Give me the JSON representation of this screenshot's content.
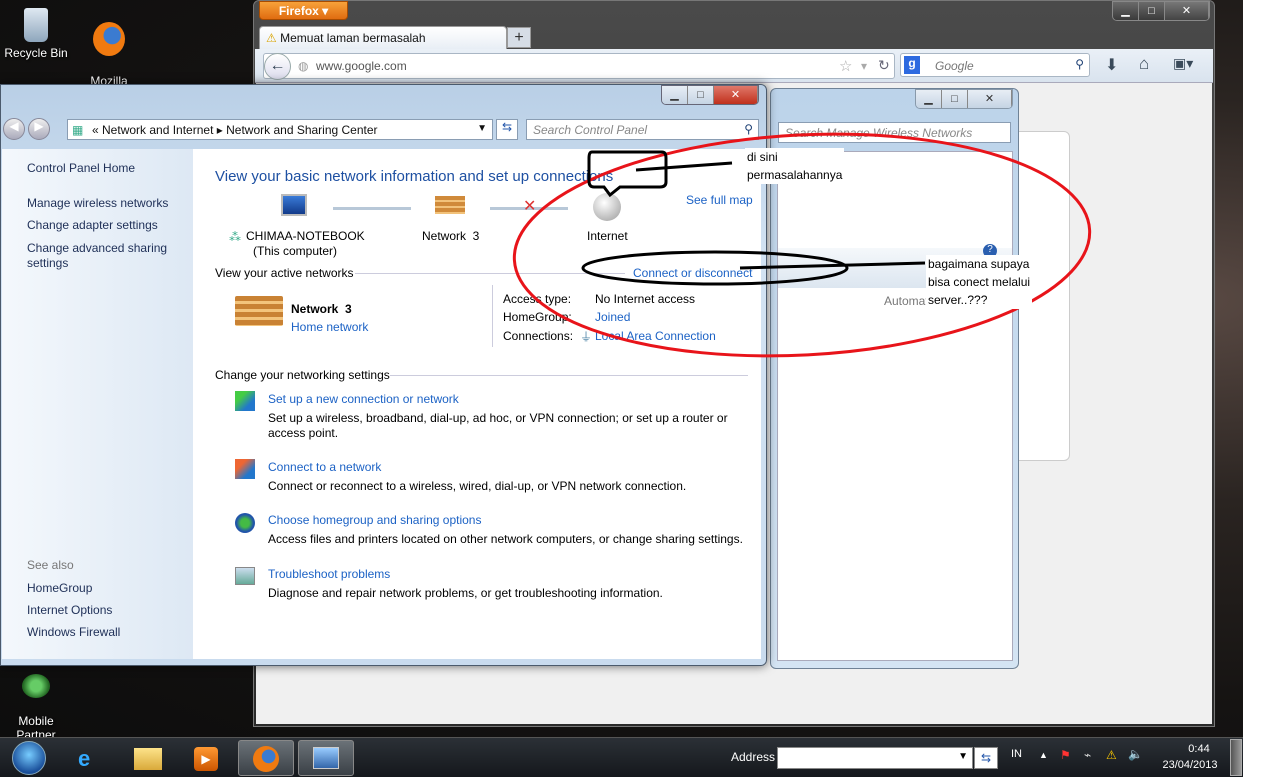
{
  "desktop": {
    "icons": [
      {
        "label": "Recycle Bin",
        "icon": "recycle-bin-icon"
      },
      {
        "label": "Mozilla\nFirefox",
        "icon": "firefox-icon"
      },
      {
        "label": "Mobile\nPartner",
        "icon": "mobile-partner-icon"
      }
    ]
  },
  "firefox": {
    "menu_button": "Firefox",
    "tab_title": "Memuat laman bermasalah",
    "new_tab": "+",
    "url": "www.google.com",
    "search_placeholder": "Google"
  },
  "wireless_window": {
    "search_placeholder": "Search Manage Wireless Networks",
    "partial_text": "Automat"
  },
  "control_panel": {
    "breadcrumb": [
      "Network and Internet",
      "Network and Sharing Center"
    ],
    "search_placeholder": "Search Control Panel",
    "sidebar": {
      "items": [
        "Control Panel Home",
        "Manage wireless networks",
        "Change adapter settings",
        "Change advanced sharing settings"
      ],
      "see_also_label": "See also",
      "see_also": [
        "HomeGroup",
        "Internet Options",
        "Windows Firewall"
      ]
    },
    "heading": "View your basic network information and set up connections",
    "see_full_map": "See full map",
    "map": {
      "computer": "CHIMAA-NOTEBOOK",
      "computer_sub": "(This computer)",
      "network": "Network  3",
      "internet": "Internet"
    },
    "active_networks_label": "View your active networks",
    "connect_disconnect": "Connect or disconnect",
    "network": {
      "name": "Network  3",
      "type": "Home network",
      "access_type_label": "Access type:",
      "access_type": "No Internet access",
      "homegroup_label": "HomeGroup:",
      "homegroup": "Joined",
      "connections_label": "Connections:",
      "connection": "Local Area Connection"
    },
    "change_settings_label": "Change your networking settings",
    "tasks": [
      {
        "title": "Set up a new connection or network",
        "desc": "Set up a wireless, broadband, dial-up, ad hoc, or VPN connection; or set up a router or access point."
      },
      {
        "title": "Connect to a network",
        "desc": "Connect or reconnect to a wireless, wired, dial-up, or VPN network connection."
      },
      {
        "title": "Choose homegroup and sharing options",
        "desc": "Access files and printers located on other network computers, or change sharing settings."
      },
      {
        "title": "Troubleshoot problems",
        "desc": "Diagnose and repair network problems, or get troubleshooting information."
      }
    ]
  },
  "annotations": {
    "note1": "di sini\npermasalahannya",
    "note2": "bagaimana supaya\nbisa conect melalui\nserver..???",
    "colors": {
      "ellipse": "#e8141a",
      "marker": "#000000"
    }
  },
  "taskbar": {
    "address_label": "Address",
    "address_value": "",
    "language": "IN",
    "time": "0:44",
    "date": "23/04/2013"
  }
}
